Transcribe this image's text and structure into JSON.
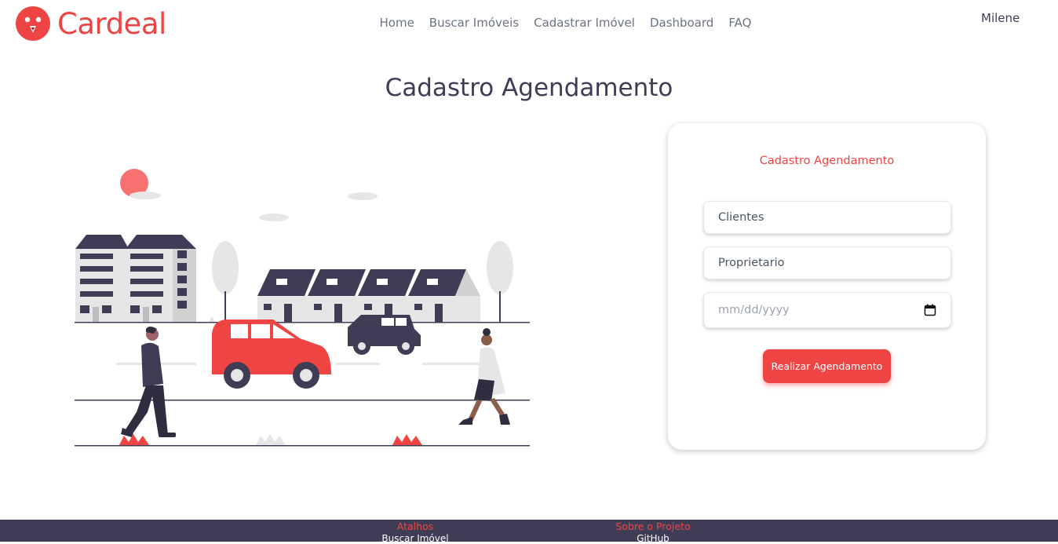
{
  "brand": {
    "name": "Cardeal"
  },
  "nav": {
    "links": [
      {
        "label": "Home"
      },
      {
        "label": "Buscar Imóveis"
      },
      {
        "label": "Cadastrar Imóvel"
      },
      {
        "label": "Dashboard"
      },
      {
        "label": "FAQ"
      }
    ],
    "user": "Milene"
  },
  "page": {
    "title": "Cadastro Agendamento"
  },
  "form": {
    "title": "Cadastro Agendamento",
    "clientes_placeholder": "Clientes",
    "proprietario_placeholder": "Proprietario",
    "date_placeholder": "mm/dd/yyyy",
    "submit_label": "Realizar Agendamento"
  },
  "footer": {
    "col1_heading": "Atalhos",
    "col1_link": "Buscar Imóvel",
    "col2_heading": "Sobre o Projeto",
    "col2_link": "GitHub"
  },
  "colors": {
    "accent": "#ef4444",
    "dark": "#3f3d56",
    "muted": "#e6e6e6"
  },
  "icons": {
    "logo": "bird-icon",
    "calendar": "calendar-icon"
  }
}
